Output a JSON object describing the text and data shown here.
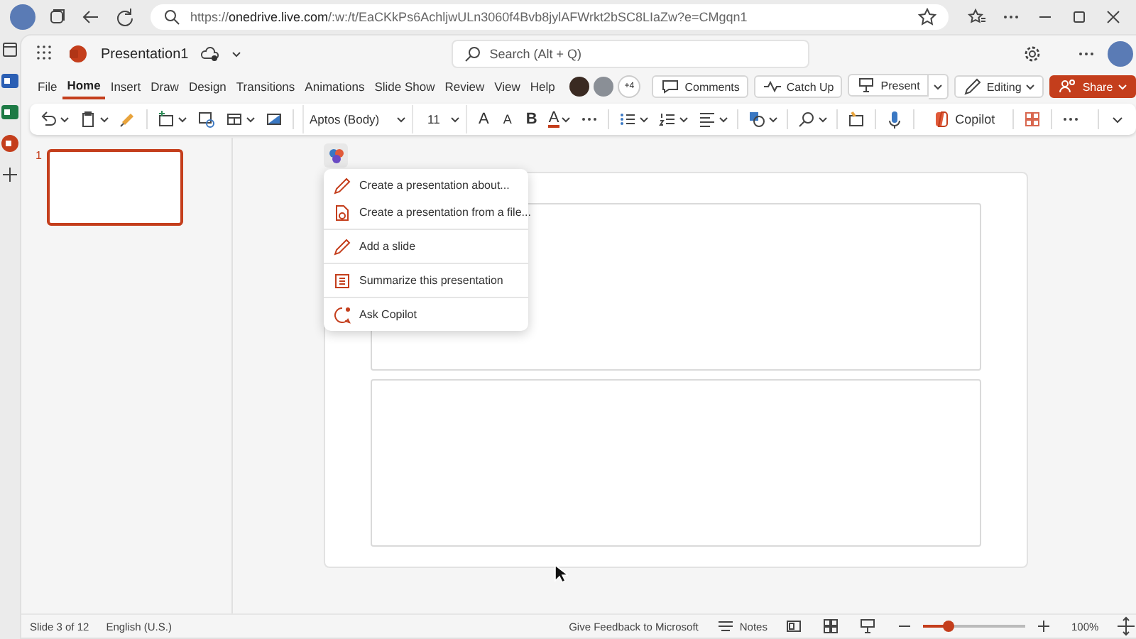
{
  "browser": {
    "url": "https://**onedrive.live.com**/:w:/t/EaCKkPs6AchljwULn3060f4Bvb8jylAFWrkt2bSC8LIaZw?e=CMgqn1"
  },
  "header": {
    "title": "Presentation1",
    "search": {
      "placeholder": "Search (Alt + Q)"
    },
    "more_people": "+4"
  },
  "tabs": [
    {
      "label": "File",
      "selected": false
    },
    {
      "label": "Home",
      "selected": true
    },
    {
      "label": "Insert",
      "selected": false
    },
    {
      "label": "Draw",
      "selected": false
    },
    {
      "label": "Design",
      "selected": false
    },
    {
      "label": "Transitions",
      "selected": false
    },
    {
      "label": "Animations",
      "selected": false
    },
    {
      "label": "Slide Show",
      "selected": false
    },
    {
      "label": "Review",
      "selected": false
    },
    {
      "label": "View",
      "selected": false
    },
    {
      "label": "Help",
      "selected": false
    }
  ],
  "actions": {
    "comments": "Comments",
    "catch_up": "Catch Up",
    "present": "Present",
    "editing": "Editing",
    "share": "Share"
  },
  "ribbon": {
    "font": "Aptos (Body)",
    "size": "11",
    "grow": "A",
    "shrink": "A",
    "bold": "B",
    "font_color": "A",
    "copilot": "Copilot"
  },
  "slides": [
    {
      "number": "1",
      "selected": true
    }
  ],
  "copilot_menu": {
    "groups": [
      {
        "items": [
          {
            "label": "Create a presentation about...",
            "kind": "pencil"
          },
          {
            "label": "Create a presentation from a file...",
            "kind": "file"
          }
        ]
      },
      {
        "items": [
          {
            "label": "Add a slide",
            "kind": "pencil"
          }
        ]
      },
      {
        "items": [
          {
            "label": "Summarize this presentation",
            "kind": "summary"
          }
        ]
      },
      {
        "items": [
          {
            "label": "Ask Copilot",
            "kind": "chat"
          }
        ]
      }
    ]
  },
  "status_bar": {
    "slide": "Slide 3 of 12",
    "language": "English (U.S.)",
    "feedback": "Give Feedback to Microsoft",
    "notes": "Notes",
    "zoom": {
      "level": 0.25,
      "reading": "100%"
    }
  }
}
